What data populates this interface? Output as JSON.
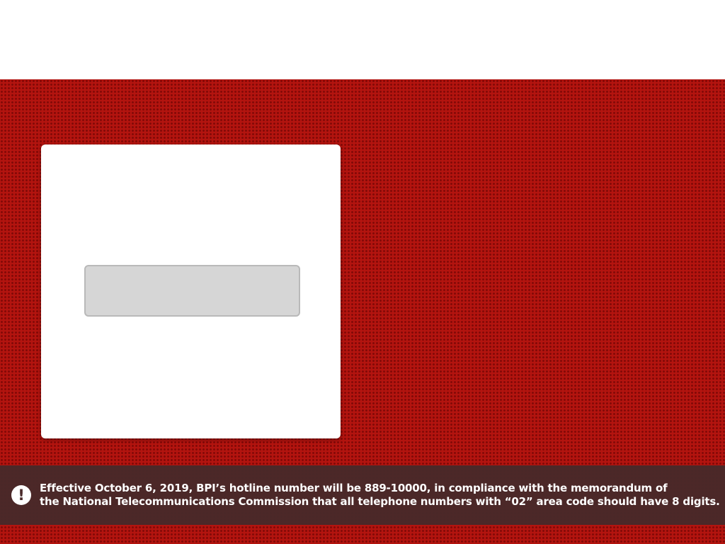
{
  "colors": {
    "hero_background": "#b3140f",
    "notice_background": "#482a2a",
    "card_background": "#ffffff",
    "button_background": "#d6d6d6"
  },
  "notice": {
    "icon": "exclamation-circle-icon",
    "icon_glyph": "!",
    "line1": "Effective October 6, 2019, BPI’s hotline number will be 889-10000, in compliance with the memorandum of",
    "line2": "the National Telecommunications Commission that all telephone numbers with “02” area code should have 8 digits."
  }
}
